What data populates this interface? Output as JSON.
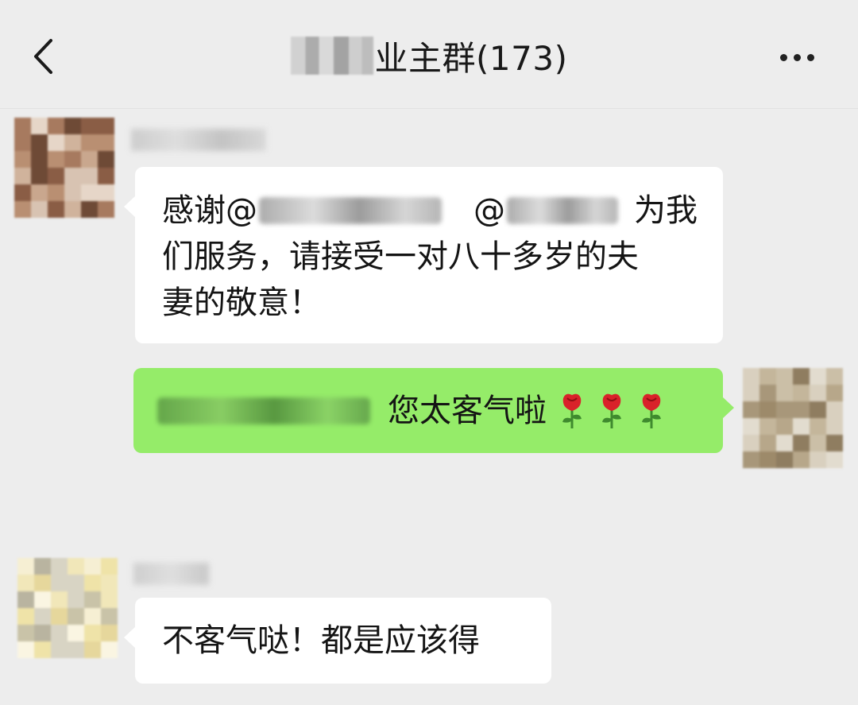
{
  "header": {
    "title": "业主群(173)"
  },
  "messages": [
    {
      "side": "left",
      "text_lines": [
        {
          "prefix": "感谢@",
          "middle": "@",
          "suffix": "为我"
        },
        "们服务，请接受一对八十多岁的夫",
        "妻的敬意！"
      ]
    },
    {
      "side": "right",
      "text": "您太客气啦",
      "emoji": [
        "rose-emoji",
        "rose-emoji",
        "rose-emoji"
      ]
    },
    {
      "side": "left",
      "text": "不客气哒！都是应该得"
    }
  ],
  "colors": {
    "background": "#ededed",
    "bubble_left": "#ffffff",
    "bubble_right": "#95ec69",
    "rose_red": "#d9222a",
    "rose_stem": "#3f8a2e"
  }
}
